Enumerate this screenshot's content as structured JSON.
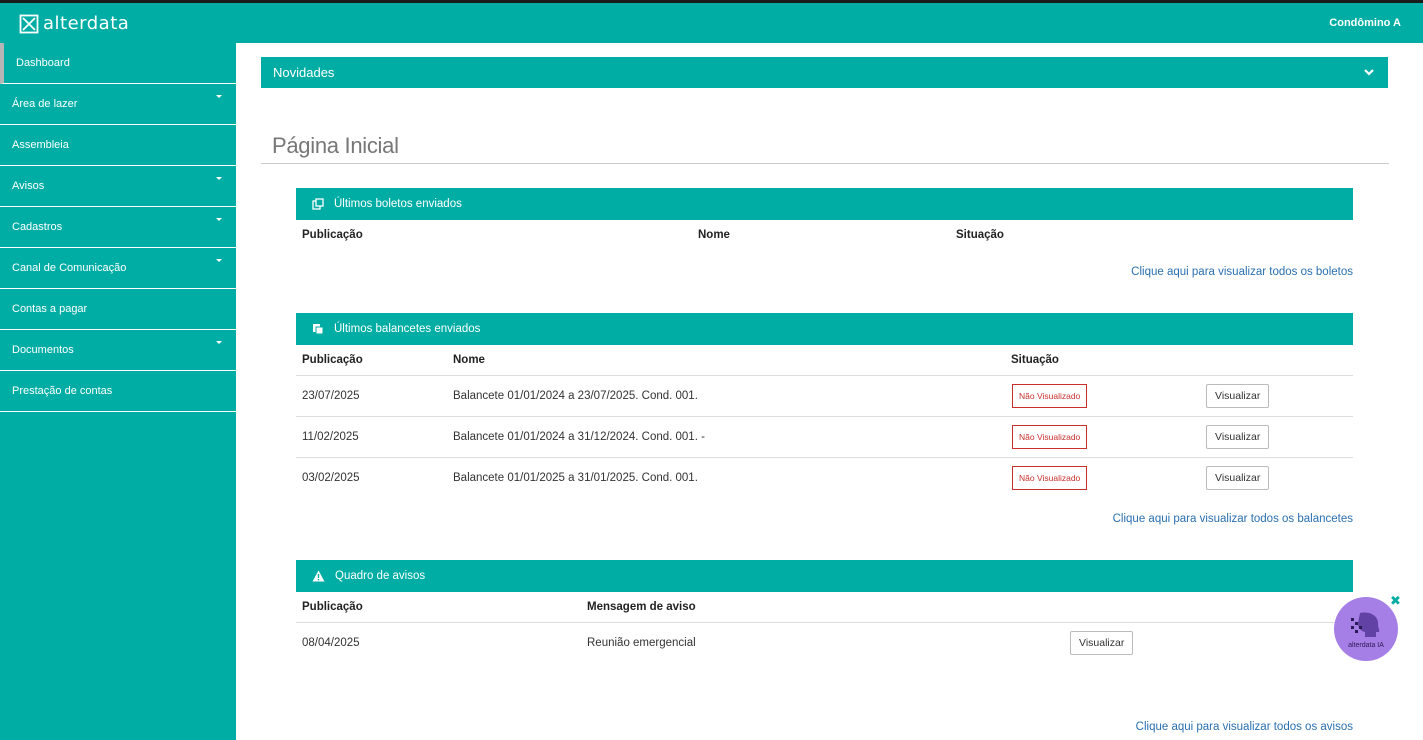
{
  "header": {
    "logo_text": "alterdata",
    "user": "Condômino A"
  },
  "sidebar": {
    "items": [
      {
        "label": "Dashboard",
        "has_caret": false,
        "active": true
      },
      {
        "label": "Área de lazer",
        "has_caret": true
      },
      {
        "label": "Assembleia",
        "has_caret": false
      },
      {
        "label": "Avisos",
        "has_caret": true
      },
      {
        "label": "Cadastros",
        "has_caret": true
      },
      {
        "label": "Canal de Comunicação",
        "has_caret": true
      },
      {
        "label": "Contas a pagar",
        "has_caret": false
      },
      {
        "label": "Documentos",
        "has_caret": true
      },
      {
        "label": "Prestação de contas",
        "has_caret": false
      }
    ]
  },
  "news": {
    "label": "Novidades"
  },
  "page": {
    "title": "Página Inicial"
  },
  "boletos": {
    "title": "Últimos boletos enviados",
    "columns": [
      "Publicação",
      "Nome",
      "Situação"
    ],
    "link": "Clique aqui para visualizar todos os boletos"
  },
  "balancetes": {
    "title": "Últimos balancetes enviados",
    "columns": [
      "Publicação",
      "Nome",
      "Situação"
    ],
    "rows": [
      {
        "date": "23/07/2025",
        "name": "Balancete 01/01/2024 a 23/07/2025. Cond. 001.",
        "status": "Não Visualizado",
        "action": "Visualizar"
      },
      {
        "date": "11/02/2025",
        "name": "Balancete 01/01/2024 a 31/12/2024. Cond. 001. -",
        "status": "Não Visualizado",
        "action": "Visualizar"
      },
      {
        "date": "03/02/2025",
        "name": "Balancete 01/01/2025 a 31/01/2025. Cond. 001.",
        "status": "Não Visualizado",
        "action": "Visualizar"
      }
    ],
    "link": "Clique aqui para visualizar todos os balancetes"
  },
  "avisos": {
    "title": "Quadro de avisos",
    "columns": [
      "Publicação",
      "Mensagem de aviso"
    ],
    "rows": [
      {
        "date": "08/04/2025",
        "message": "Reunião emergencial",
        "action": "Visualizar"
      }
    ],
    "link": "Clique aqui para visualizar todos os avisos"
  },
  "assistant": {
    "label": "alterdata IA"
  },
  "colors": {
    "brand": "#00ada5",
    "status_unviewed": "#c9302c",
    "link": "#2a6fb0",
    "assistant": "#a67fe6"
  }
}
